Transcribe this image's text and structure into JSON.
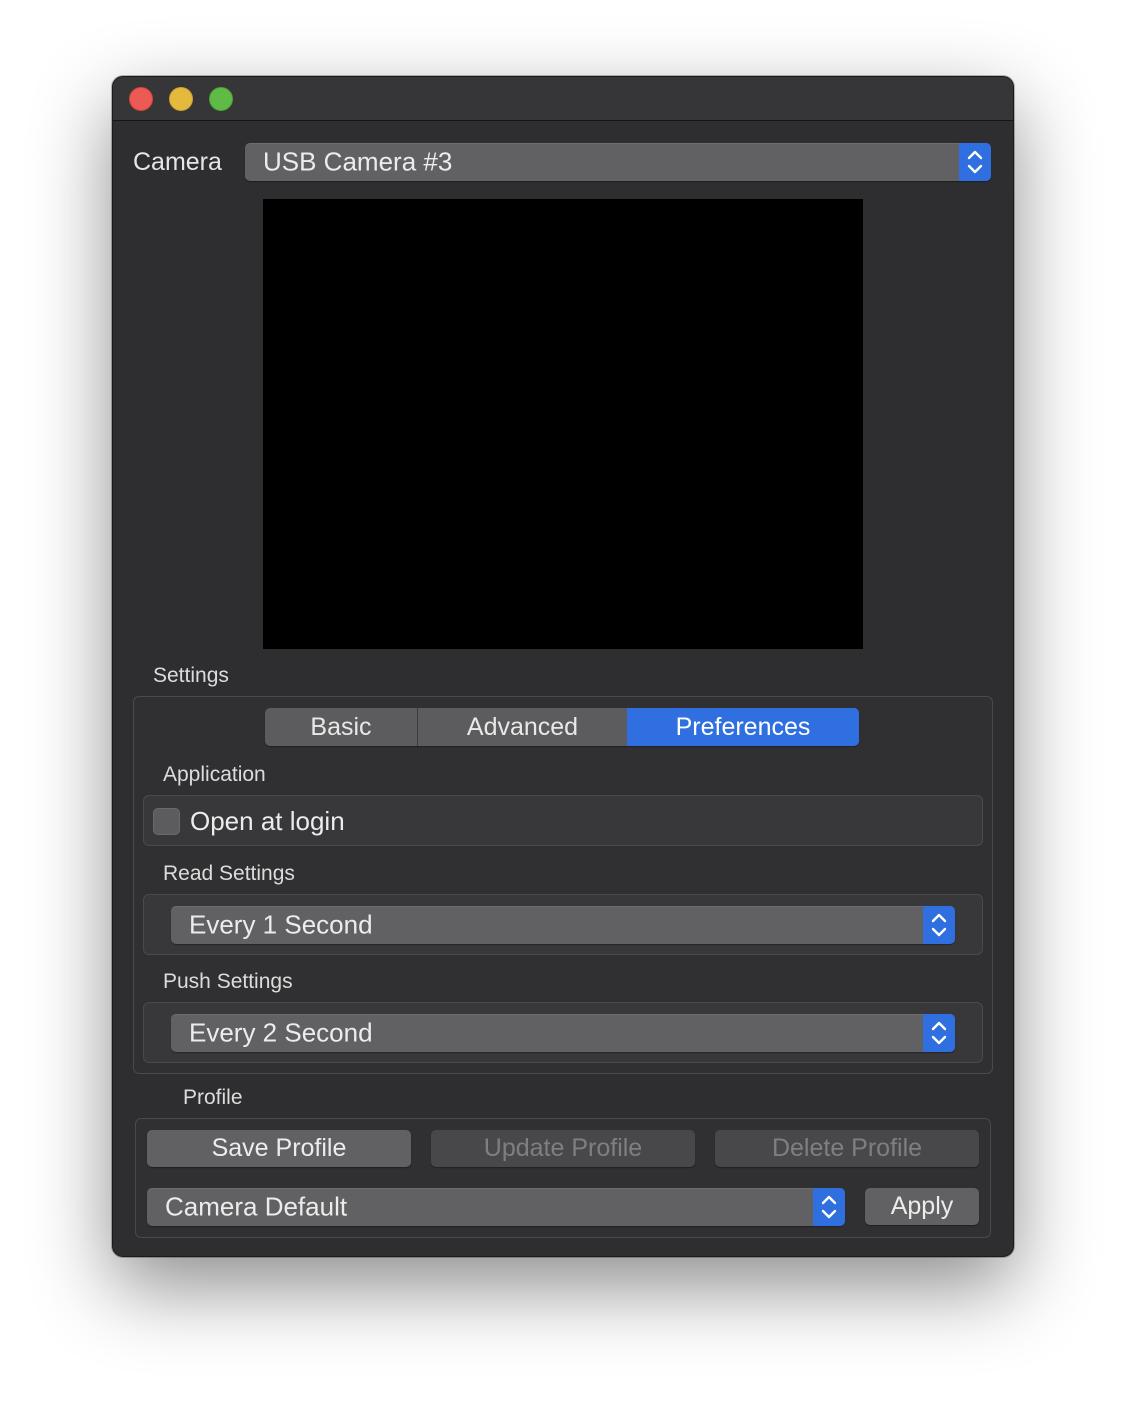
{
  "window": {
    "traffic_lights": [
      "close",
      "minimize",
      "zoom"
    ]
  },
  "camera": {
    "label": "Camera",
    "selected": "USB Camera #3"
  },
  "settings": {
    "label": "Settings",
    "tabs": [
      {
        "label": "Basic",
        "active": false
      },
      {
        "label": "Advanced",
        "active": false
      },
      {
        "label": "Preferences",
        "active": true
      }
    ],
    "application": {
      "label": "Application",
      "open_at_login_label": "Open at login",
      "open_at_login_checked": false
    },
    "read_settings": {
      "label": "Read Settings",
      "selected": "Every 1 Second"
    },
    "push_settings": {
      "label": "Push Settings",
      "selected": "Every 2 Second"
    }
  },
  "profile": {
    "label": "Profile",
    "save_label": "Save Profile",
    "update_label": "Update Profile",
    "delete_label": "Delete Profile",
    "selected": "Camera Default",
    "apply_label": "Apply"
  },
  "colors": {
    "accent": "#2f6fe0",
    "window_bg": "#2e2e30",
    "close": "#ec5a53",
    "minimize": "#e3b93e",
    "zoom": "#5fba46"
  }
}
